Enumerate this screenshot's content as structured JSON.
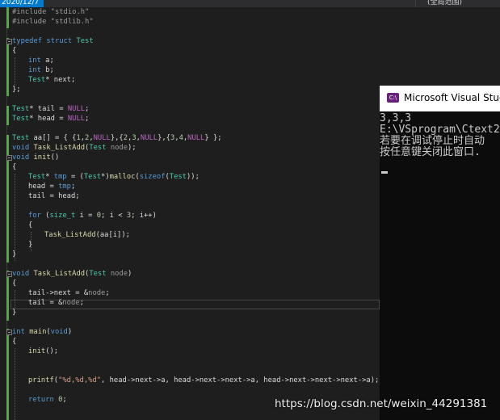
{
  "window": {
    "top_left_tab": "2020/12/7",
    "top_right_dropdown": "(全局范围)"
  },
  "editor": {
    "lines": {
      "l1": "#include \"stdio.h\"",
      "l2": "#include \"stdlib.h\"",
      "l4_kw": "typedef struct",
      "l4_ty": "Test",
      "l5": "{",
      "l6_kw": "int",
      "l6_rest": " a;",
      "l7_kw": "int",
      "l7_rest": " b;",
      "l8_ty": "Test",
      "l8_rest": "* next;",
      "l9": "};",
      "l11_ty": "Test",
      "l11_a": "* tail = ",
      "l11_mc": "NULL",
      "l11_b": ";",
      "l12_ty": "Test",
      "l12_a": "* head = ",
      "l12_mc": "NULL",
      "l12_b": ";",
      "l14_ty": "Test",
      "l14_a": " aa[] = { {",
      "l14_n1": "1",
      "l14_c1": ",",
      "l14_n2": "2",
      "l14_c2": ",",
      "l14_m1": "NULL",
      "l14_b": "},{",
      "l14_n3": "2",
      "l14_c3": ",",
      "l14_n4": "3",
      "l14_c4": ",",
      "l14_m2": "NULL",
      "l14_c": "},{",
      "l14_n5": "3",
      "l14_c5": ",",
      "l14_n6": "4",
      "l14_c6": ",",
      "l14_m3": "NULL",
      "l14_d": "} };",
      "l15_kw": "void",
      "l15_fn": "Task_ListAdd",
      "l15_a": "(",
      "l15_ty": "Test",
      "l15_pm": " node",
      "l15_b": ");",
      "l16_kw": "void",
      "l16_fn": "init",
      "l16_b": "()",
      "l17": "{",
      "l18_ty": "Test",
      "l18_a": "* ",
      "l18_v": "tmp",
      "l18_b": " = (",
      "l18_ty2": "Test",
      "l18_c": "*)",
      "l18_fn": "malloc",
      "l18_d": "(",
      "l18_kw": "sizeof",
      "l18_e": "(",
      "l18_ty3": "Test",
      "l18_f": "));",
      "l19_a": "head = ",
      "l19_v": "tmp",
      "l19_b": ";",
      "l20": "tail = head;",
      "l22_kw": "for",
      "l22_a": " (",
      "l22_ty": "size_t",
      "l22_b": " i = ",
      "l22_n1": "0",
      "l22_c": "; i < ",
      "l22_n2": "3",
      "l22_d": "; i++)",
      "l23": "{",
      "l24_fn": "Task_ListAdd",
      "l24_rest": "(aa[i]);",
      "l25": "}",
      "l26": "}",
      "l28_kw": "void",
      "l28_fn": "Task_ListAdd",
      "l28_a": "(",
      "l28_ty": "Test",
      "l28_pm": " node",
      "l28_b": ")",
      "l29": "{",
      "l30_a": "tail->next = &",
      "l30_pm": "node",
      "l30_b": ";",
      "l31_a": "tail = &",
      "l31_pm": "node",
      "l31_b": ";",
      "l32": "}",
      "l34_kw": "int",
      "l34_fn": "main",
      "l34_a": "(",
      "l34_kw2": "void",
      "l34_b": ")",
      "l35": "{",
      "l36_fn": "init",
      "l36_rest": "();",
      "l39_fn": "printf",
      "l39_a": "(",
      "l39_st": "\"%d,%d,%d\"",
      "l39_rest": ", head->next->a, head->next->next->a, head->next->next->next->a);",
      "l41_kw": "return",
      "l41_n": "0",
      "l41_b": ";"
    }
  },
  "console": {
    "title": "Microsoft Visual Studio",
    "icon_label": "C:\\",
    "output": [
      "3,3,3",
      "E:\\VSprogram\\Ctext2",
      "若要在调试停止时自动",
      "按任意键关闭此窗口."
    ]
  },
  "watermark": "https://blog.csdn.net/weixin_44291381",
  "colors": {
    "keyword": "#569cd6",
    "type": "#4ec9b0",
    "function": "#dcdcaa",
    "string": "#d69d85",
    "number": "#b5cea8",
    "macro": "#bd63c5",
    "editor_bg": "#1e1e1e",
    "console_bg": "#0c0c0c"
  }
}
